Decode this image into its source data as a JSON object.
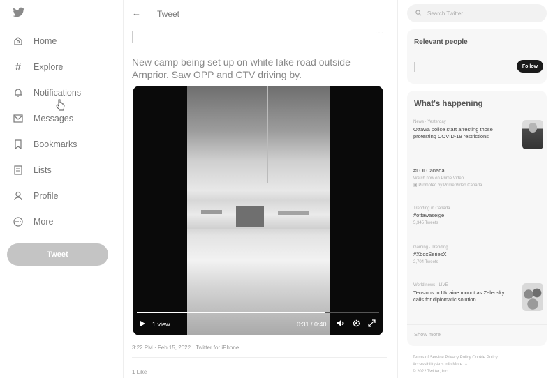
{
  "nav": {
    "items": [
      {
        "label": "Home",
        "icon": "home-icon"
      },
      {
        "label": "Explore",
        "icon": "hashtag-icon"
      },
      {
        "label": "Notifications",
        "icon": "bell-icon"
      },
      {
        "label": "Messages",
        "icon": "envelope-icon"
      },
      {
        "label": "Bookmarks",
        "icon": "bookmark-icon"
      },
      {
        "label": "Lists",
        "icon": "list-icon"
      },
      {
        "label": "Profile",
        "icon": "person-icon"
      },
      {
        "label": "More",
        "icon": "more-circle-icon"
      }
    ],
    "tweet_button": "Tweet"
  },
  "header": {
    "back": "←",
    "title": "Tweet"
  },
  "tweet": {
    "text": "New camp being set up on white lake road outside Arnprior. Saw OPP and CTV driving by.",
    "meta": "3:22 PM · Feb 15, 2022 · Twitter for iPhone",
    "likes": "1 Like"
  },
  "video": {
    "views": "1 view",
    "time": "0:31 / 0:40",
    "progress": 0.775
  },
  "search": {
    "placeholder": "Search Twitter"
  },
  "relevant": {
    "title": "Relevant people",
    "follow": "Follow"
  },
  "happening": {
    "title": "What's happening",
    "trends": [
      {
        "context": "News · Yesterday",
        "text": "Ottawa police start arresting those protesting COVID-19 restrictions",
        "extra": ""
      },
      {
        "context": "",
        "text": "#LOLCanada",
        "extra": "Watch now on Prime Video"
      },
      {
        "context": "Trending in Canada",
        "text": "#ottawaseige",
        "extra": "5,345 Tweets"
      },
      {
        "context": "Gaming · Trending",
        "text": "#XboxSeriesX",
        "extra": "2,704 Tweets"
      },
      {
        "context": "World news · LIVE",
        "text": "Tensions in Ukraine mount as Zelensky calls for diplomatic solution",
        "extra": ""
      }
    ],
    "promoted": "Promoted by Prime Video Canada",
    "show_more": "Show more"
  },
  "footer": {
    "line1": "Terms of Service  Privacy Policy  Cookie Policy",
    "line2": "Accessibility  Ads info  More ···",
    "line3": "© 2022 Twitter, Inc."
  }
}
